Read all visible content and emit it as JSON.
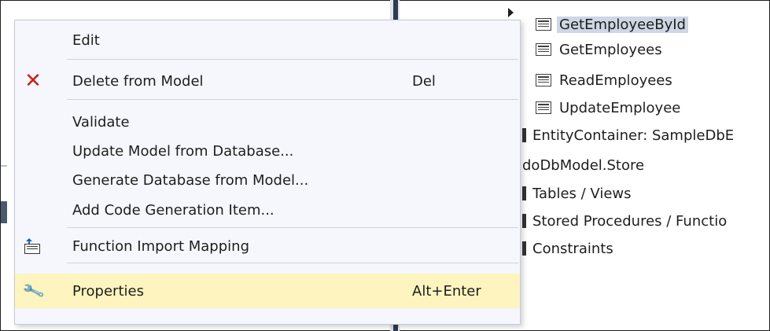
{
  "tree": {
    "items": [
      {
        "label": "GetEmployeeById",
        "icon": "stored-procedure-icon",
        "selected": true
      },
      {
        "label": "GetEmployees",
        "icon": "stored-procedure-icon"
      },
      {
        "label": "ReadEmployees",
        "icon": "stored-procedure-icon"
      },
      {
        "label": "UpdateEmployee",
        "icon": "stored-procedure-icon"
      },
      {
        "label": "EntityContainer: SampleDbE",
        "icon": "container-icon"
      },
      {
        "label": "doDbModel.Store",
        "icon": "none"
      },
      {
        "label": "Tables / Views",
        "icon": "folder-icon"
      },
      {
        "label": "Stored Procedures / Functio",
        "icon": "folder-icon"
      },
      {
        "label": "Constraints",
        "icon": "folder-icon"
      }
    ]
  },
  "menu": {
    "items": [
      {
        "label": "Edit",
        "shortcut": "",
        "icon": "none"
      },
      {
        "label": "Delete from Model",
        "shortcut": "Del",
        "icon": "delete-x-icon"
      },
      {
        "label": "Validate",
        "shortcut": "",
        "icon": "none"
      },
      {
        "label": "Update Model from Database...",
        "shortcut": "",
        "icon": "none"
      },
      {
        "label": "Generate Database from Model...",
        "shortcut": "",
        "icon": "none"
      },
      {
        "label": "Add Code Generation Item...",
        "shortcut": "",
        "icon": "none"
      },
      {
        "label": "Function Import Mapping",
        "shortcut": "",
        "icon": "function-import-mapping-icon"
      },
      {
        "label": "Properties",
        "shortcut": "Alt+Enter",
        "icon": "wrench-icon",
        "highlighted": true
      }
    ],
    "delete_glyph": "✕",
    "wrench_glyph": "🔧"
  },
  "colors": {
    "menu_bg": "#f5f7fc",
    "highlight": "#fdf4bf",
    "selection": "#cfd6e5",
    "delete_red": "#c8231b"
  }
}
